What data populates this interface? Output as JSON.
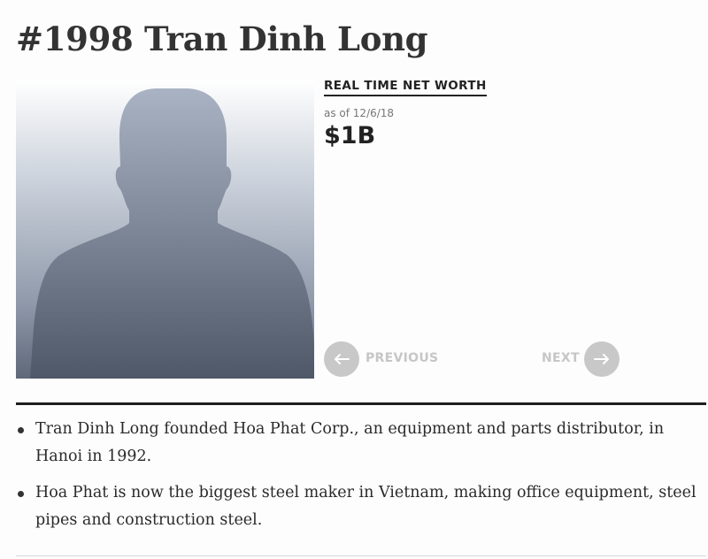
{
  "profile": {
    "title": "#1998 Tran Dinh Long",
    "net_worth_label": "REAL TIME NET WORTH",
    "as_of": "as of 12/6/18",
    "net_worth": "$1B",
    "photo_icon": "person-silhouette-icon"
  },
  "nav": {
    "previous_label": "PREVIOUS",
    "next_label": "NEXT",
    "previous_icon": "arrow-left-icon",
    "next_icon": "arrow-right-icon"
  },
  "facts": [
    "Tran Dinh Long founded Hoa Phat Corp., an equipment and parts distributor, in Hanoi in 1992.",
    "Hoa Phat is now the biggest steel maker in Vietnam, making office equipment, steel pipes and construction steel."
  ],
  "colors": {
    "text": "#333333",
    "nav_disabled": "#c8c8c8",
    "rule": "#1e1e1e"
  }
}
